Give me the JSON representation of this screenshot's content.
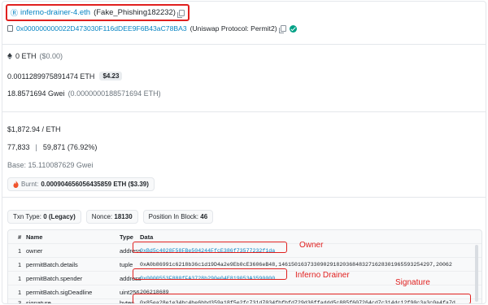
{
  "header": {
    "ens_name": "inferno-drainer-4.eth",
    "ens_label": "(Fake_Phishing182232)"
  },
  "to_contract": {
    "address": "0x000000000022D473030F116dDEE9F6B43aC78BA3",
    "label": "(Uniswap Protocol: Permit2)"
  },
  "value": {
    "eth": "0 ETH",
    "usd": "($0.00)"
  },
  "fee": {
    "eth": "0.0011289975891474 ETH",
    "usd": "$4.23"
  },
  "gas_price": {
    "gwei": "18.8571694 Gwei",
    "eth": "(0.0000000188571694 ETH)"
  },
  "eth_price": "$1,872.94 / ETH",
  "gas_usage": {
    "limit": "77,833",
    "used": "59,871 (76.92%)",
    "separator": "|"
  },
  "base_fee": "Base: 15.110087629 Gwei",
  "burnt": {
    "label": "Burnt:",
    "value": "0.000904656056435859 ETH ($3.39)"
  },
  "tx_attrs": {
    "txn_type_label": "Txn Type:",
    "txn_type_value": "0 (Legacy)",
    "nonce_label": "Nonce:",
    "nonce_value": "18130",
    "position_label": "Position In Block:",
    "position_value": "46"
  },
  "table": {
    "headers": [
      "#",
      "Name",
      "Type",
      "Data"
    ],
    "rows": [
      {
        "idx": "1",
        "name": "owner",
        "type": "address",
        "data": "0xBd5c4028F58FBe504244FfcE386f73577232f1da"
      },
      {
        "idx": "1",
        "name": "permitBatch.details",
        "type": "tuple",
        "data": "0xA0b86991c6218b36c1d19D4a2e9Eb0cE3606eB48,146150163733090291820368483271628301965593254297,20062"
      },
      {
        "idx": "1",
        "name": "permitBatch.spender",
        "type": "address",
        "data": "0x0000553F880fFA3728b290e04E819053A3590000"
      },
      {
        "idx": "1",
        "name": "permitBatch.sigDeadline",
        "type": "uint256",
        "data": "206218689"
      },
      {
        "idx": "3",
        "name": "signature",
        "type": "bytes",
        "data": "0x85ea28e1e34bc4be6bbd359a18f5e2fc731d7034fbfbfd729d36ffaddd5c885f607264cd7c314dc12f90c3a3c0a4fa7d"
      }
    ]
  },
  "annotations": {
    "owner": "Owner",
    "drainer": "Inferno Drainer",
    "signature": "Signature"
  },
  "colors": {
    "link": "#0784c3",
    "annotation": "#e0201f",
    "verified": "#00a186"
  }
}
